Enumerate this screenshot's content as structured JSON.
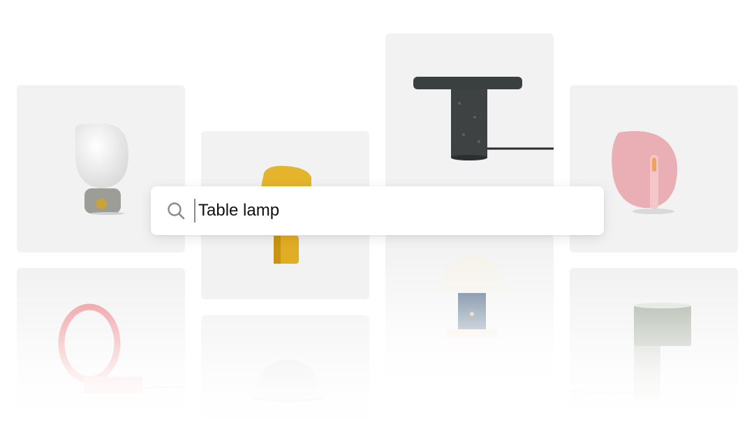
{
  "search": {
    "value": "Table lamp",
    "icon": "search-icon"
  },
  "results": [
    {
      "icon": "white-globe-lamp-icon"
    },
    {
      "icon": "yellow-angled-lamp-icon"
    },
    {
      "icon": "stone-pedestal-lamp-icon"
    },
    {
      "icon": "pink-glass-disc-lamp-icon"
    },
    {
      "icon": "pink-ring-lamp-icon"
    },
    {
      "icon": "white-dome-lamp-icon"
    },
    {
      "icon": "mushroom-lamp-icon"
    },
    {
      "icon": "sage-cylinder-lamp-icon"
    }
  ],
  "colors": {
    "card_bg": "#f2f2f2",
    "page_bg": "#ffffff",
    "yellow_lamp": "#e4b42c",
    "stone_lamp": "#3a3f40",
    "pink_disc": "#e8a7ad",
    "pink_ring": "#ec8f93",
    "mushroom_stem": "#3d5a7a",
    "sage_lamp": "#aab3a6"
  }
}
